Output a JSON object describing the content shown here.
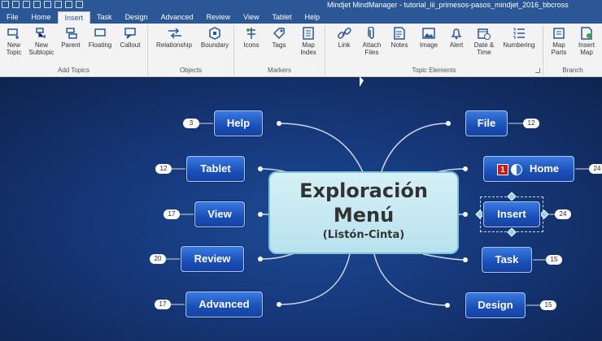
{
  "window": {
    "title": "Mindjet MindManager - tutorial_iii_primesos-pasos_mindjet_2016_bbcross"
  },
  "tabs": [
    "File",
    "Home",
    "Insert",
    "Task",
    "Design",
    "Advanced",
    "Review",
    "View",
    "Tablet",
    "Help"
  ],
  "active_tab": "Insert",
  "ribbon": {
    "groups": [
      {
        "name": "Add Topics",
        "commands": [
          [
            "New",
            "Topic"
          ],
          [
            "New",
            "Subtopic"
          ],
          [
            "Parent",
            ""
          ],
          [
            "Floating",
            ""
          ],
          [
            "Callout",
            ""
          ]
        ]
      },
      {
        "name": "Objects",
        "commands": [
          [
            "Relationship",
            ""
          ],
          [
            "Boundary",
            ""
          ]
        ]
      },
      {
        "name": "Markers",
        "commands": [
          [
            "Icons",
            ""
          ],
          [
            "Tags",
            ""
          ],
          [
            "Map",
            "Index"
          ]
        ]
      },
      {
        "name": "Topic Elements",
        "commands": [
          [
            "Link",
            ""
          ],
          [
            "Attach",
            "Files"
          ],
          [
            "Notes",
            ""
          ],
          [
            "Image",
            ""
          ],
          [
            "Alert",
            ""
          ],
          [
            "Date &",
            "Time"
          ],
          [
            "Numbering",
            ""
          ]
        ]
      },
      {
        "name": "Branch",
        "commands": [
          [
            "Map",
            "Parts"
          ],
          [
            "Insert",
            "Map"
          ]
        ]
      }
    ]
  },
  "map": {
    "central": {
      "line1": "Exploración",
      "line2": "Menú",
      "line3": "(Listón-Cinta)"
    },
    "left_topics": [
      {
        "label": "Help",
        "count": "3"
      },
      {
        "label": "Tablet",
        "count": "12"
      },
      {
        "label": "View",
        "count": "17"
      },
      {
        "label": "Review",
        "count": "20"
      },
      {
        "label": "Advanced",
        "count": "17"
      }
    ],
    "right_topics": [
      {
        "label": "File",
        "count": "12"
      },
      {
        "label": "Home",
        "count": "24",
        "priority": "1"
      },
      {
        "label": "Insert",
        "count": "24",
        "selected": true
      },
      {
        "label": "Task",
        "count": "15"
      },
      {
        "label": "Design",
        "count": "15"
      }
    ]
  },
  "colors": {
    "canvas_bg": "#16387a",
    "topic_fill": "#1a4fb8",
    "central_fill": "#c6e9f2",
    "title_bar": "#2b5797",
    "priority": "#d01616"
  }
}
